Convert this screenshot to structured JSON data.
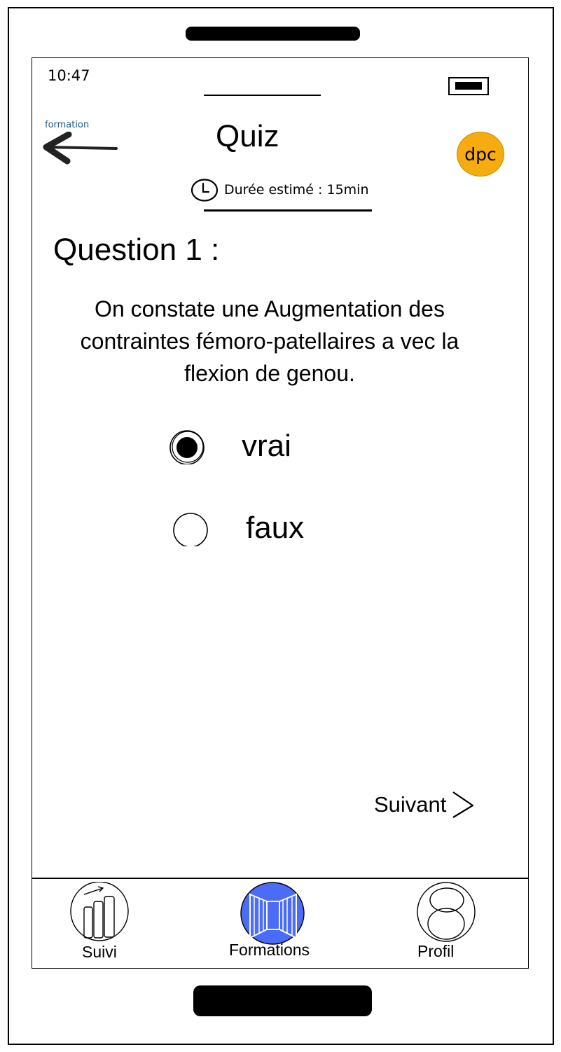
{
  "status_bar": {
    "time": "10:47"
  },
  "header": {
    "back_label": "formation",
    "title": "Quiz",
    "badge": "dpc",
    "duration": "Durée estimé : 15min"
  },
  "question": {
    "heading": "Question 1 :",
    "text": "On constate une Augmentation des contraintes fémoro-patellaires a vec la flexion de genou."
  },
  "answers": [
    {
      "label": "vrai",
      "selected": true
    },
    {
      "label": "faux",
      "selected": false
    }
  ],
  "next_label": "Suivant",
  "tabbar": {
    "items": [
      {
        "label": "Suivi",
        "icon": "bar-chart-icon",
        "active": false
      },
      {
        "label": "Formations",
        "icon": "book-icon",
        "active": true
      },
      {
        "label": "Profil",
        "icon": "user-icon",
        "active": false
      }
    ]
  },
  "colors": {
    "badge": "#f6ac10",
    "active_tab": "#4a6cf7",
    "back_label": "#1e5a8a"
  }
}
